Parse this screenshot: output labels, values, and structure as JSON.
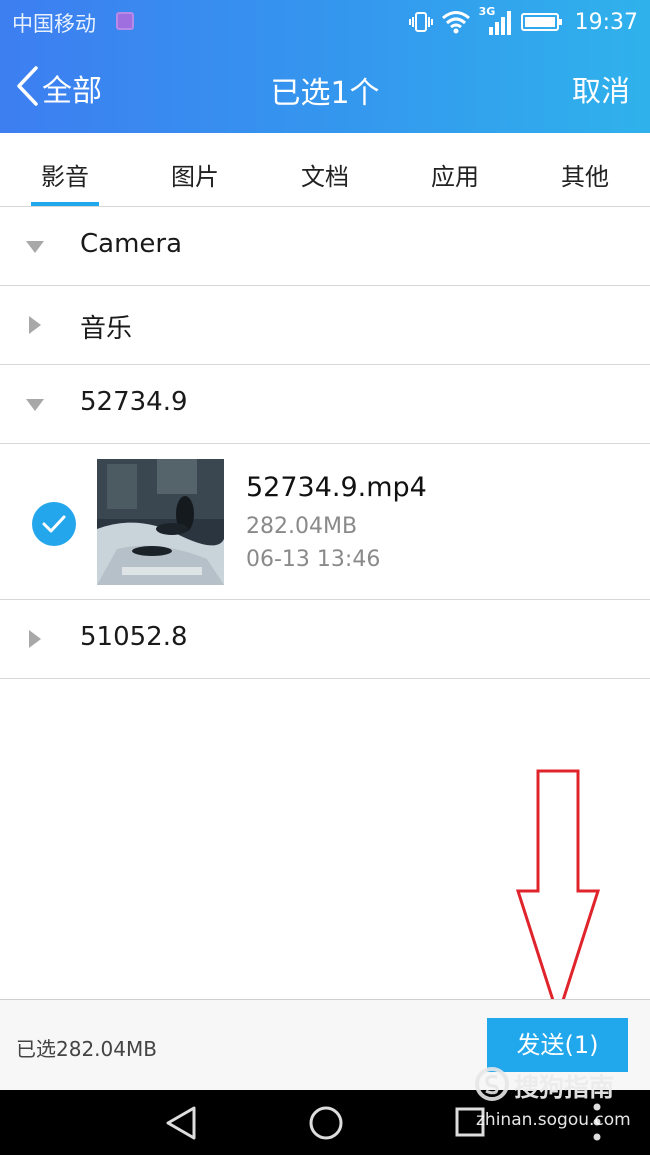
{
  "status_bar": {
    "carrier": "中国移动",
    "network": "3G",
    "time": "19:37"
  },
  "title_bar": {
    "back_label": "全部",
    "title": "已选1个",
    "cancel_label": "取消"
  },
  "tabs": [
    {
      "label": "影音",
      "active": true
    },
    {
      "label": "图片",
      "active": false
    },
    {
      "label": "文档",
      "active": false
    },
    {
      "label": "应用",
      "active": false
    },
    {
      "label": "其他",
      "active": false
    }
  ],
  "groups": [
    {
      "label": "Camera",
      "expanded": true
    },
    {
      "label": "音乐",
      "expanded": false
    },
    {
      "label": "52734.9",
      "expanded": true
    },
    {
      "label": "51052.8",
      "expanded": false
    }
  ],
  "file": {
    "name": "52734.9.mp4",
    "size": "282.04MB",
    "date": "06-13 13:46",
    "selected": true
  },
  "bottom_bar": {
    "selected_size": "已选282.04MB",
    "send_label": "发送(1)"
  },
  "watermark": {
    "brand": "搜狗指南",
    "url": "zhinan.sogou.com"
  },
  "colors": {
    "header_start": "#3d7ef1",
    "header_end": "#2fb2ec",
    "accent": "#21a7ec",
    "annotation_arrow": "#e0242c"
  },
  "icons": {
    "back": "chevron-left-icon",
    "group_collapsed": "triangle-right-icon",
    "group_expanded": "triangle-down-icon",
    "check": "check-circle-icon",
    "nav_back": "triangle-back-icon",
    "nav_home": "circle-home-icon",
    "nav_recent": "square-recent-icon"
  }
}
